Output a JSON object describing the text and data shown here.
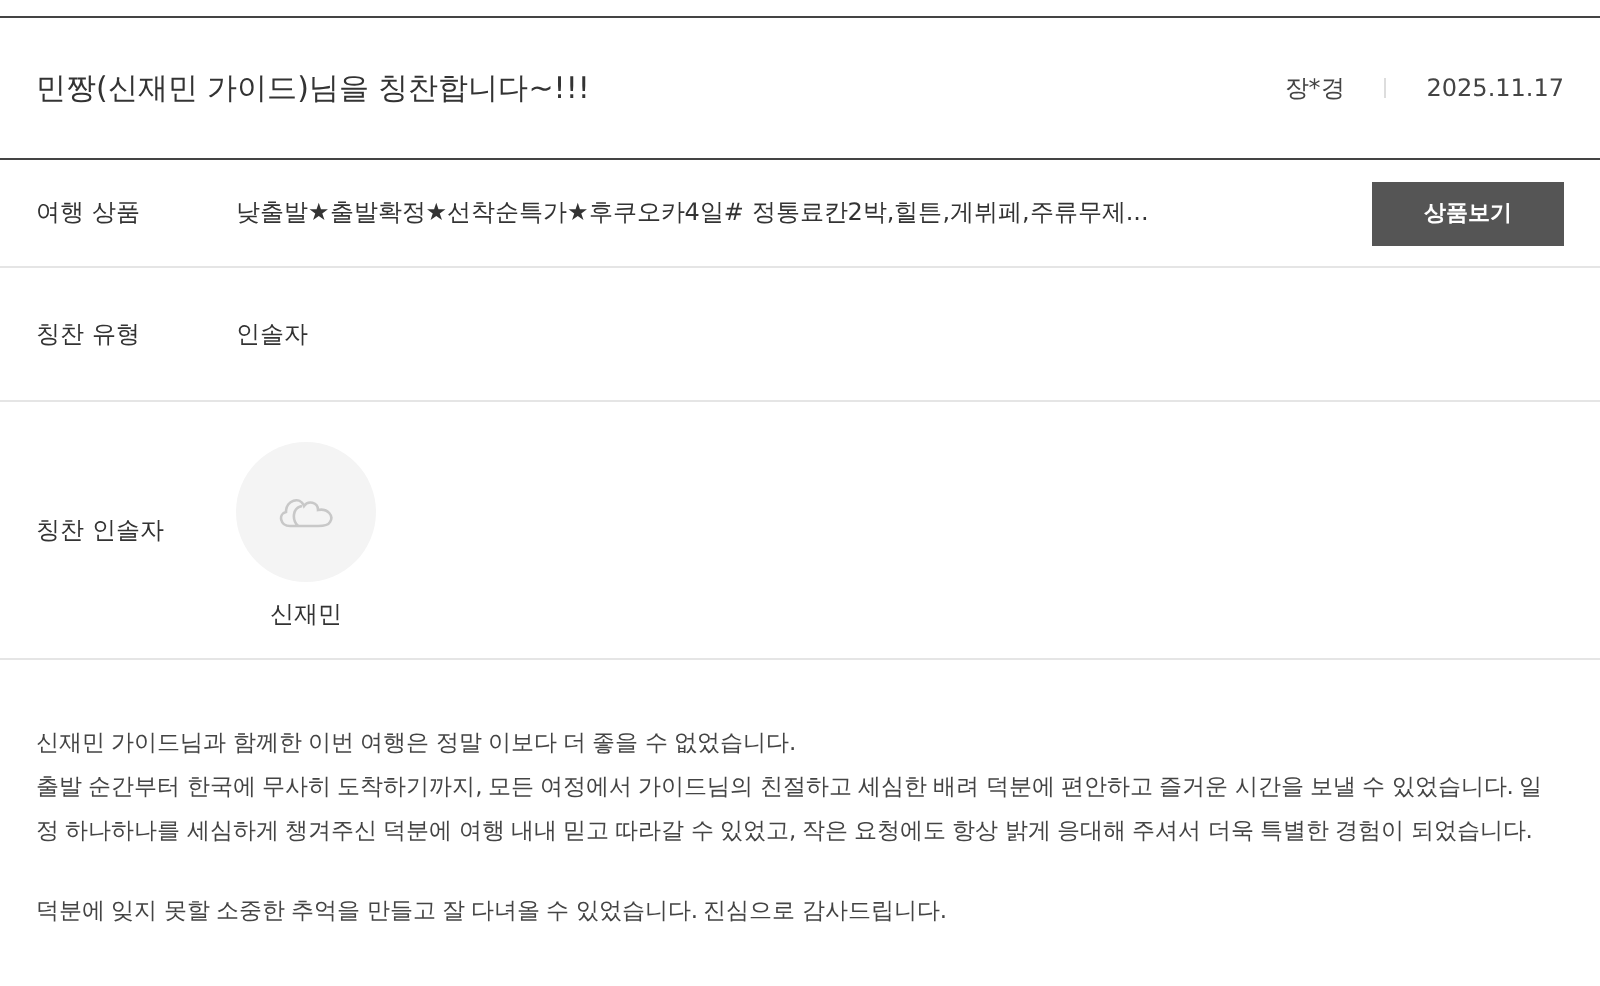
{
  "title": "민짱(신재민 가이드)님을 칭찬합니다~!!!",
  "author": "장*경",
  "date": "2025.11.17",
  "product": {
    "label": "여행 상품",
    "value": "낮출발★출발확정★선착순특가★후쿠오카4일# 정통료칸2박,힐튼,게뷔페,주류무제...",
    "button": "상품보기"
  },
  "type": {
    "label": "칭찬 유형",
    "value": "인솔자"
  },
  "guide": {
    "label": "칭찬 인솔자",
    "name": "신재민"
  },
  "body": [
    "신재민 가이드님과 함께한 이번 여행은 정말 이보다 더 좋을 수 없었습니다.",
    "출발 순간부터 한국에 무사히 도착하기까지, 모든 여정에서 가이드님의 친절하고 세심한 배려 덕분에 편안하고 즐거운 시간을 보낼 수 있었습니다. 일정 하나하나를 세심하게 챙겨주신 덕분에 여행 내내 믿고 따라갈 수 있었고, 작은 요청에도 항상 밝게 응대해 주셔서 더욱 특별한 경험이 되었습니다.",
    "덕분에 잊지 못할 소중한 추억을 만들고 잘 다녀올 수 있었습니다. 진심으로 감사드립니다."
  ]
}
